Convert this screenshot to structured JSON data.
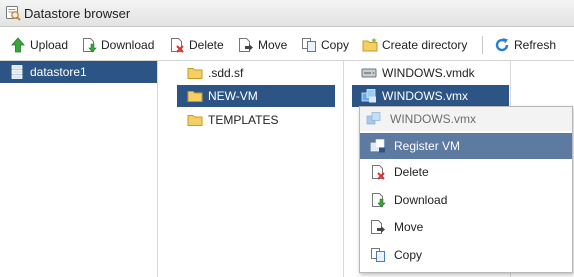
{
  "window": {
    "title": "Datastore browser",
    "icon": "datastore-search-icon"
  },
  "toolbar": {
    "upload": "Upload",
    "download": "Download",
    "delete": "Delete",
    "move": "Move",
    "copy": "Copy",
    "create_directory": "Create directory",
    "refresh": "Refresh"
  },
  "datastores": [
    {
      "label": "datastore1",
      "selected": true
    }
  ],
  "folders": [
    {
      "label": ".sdd.sf",
      "selected": false
    },
    {
      "label": "NEW-VM",
      "selected": true
    },
    {
      "label": "TEMPLATES",
      "selected": false
    }
  ],
  "files": [
    {
      "label": "WINDOWS.vmdk",
      "icon": "disk-icon",
      "selected": false
    },
    {
      "label": "WINDOWS.vmx",
      "icon": "vm-config-icon",
      "selected": true
    }
  ],
  "context_menu": {
    "header": "WINDOWS.vmx",
    "items": [
      {
        "label": "Register VM",
        "icon": "register-vm-icon",
        "highlighted": true
      },
      {
        "label": "Delete",
        "icon": "delete-icon",
        "highlighted": false
      },
      {
        "label": "Download",
        "icon": "download-icon",
        "highlighted": false
      },
      {
        "label": "Move",
        "icon": "move-icon",
        "highlighted": false
      },
      {
        "label": "Copy",
        "icon": "copy-icon",
        "highlighted": false
      }
    ]
  },
  "colors": {
    "selection": "#2c5585",
    "menu_highlight": "#5d7aa0",
    "upload_green": "#3aa53a",
    "refresh_blue": "#2a7fd4",
    "delete_red": "#d9312b",
    "folder_yellow": "#f5cf63"
  }
}
